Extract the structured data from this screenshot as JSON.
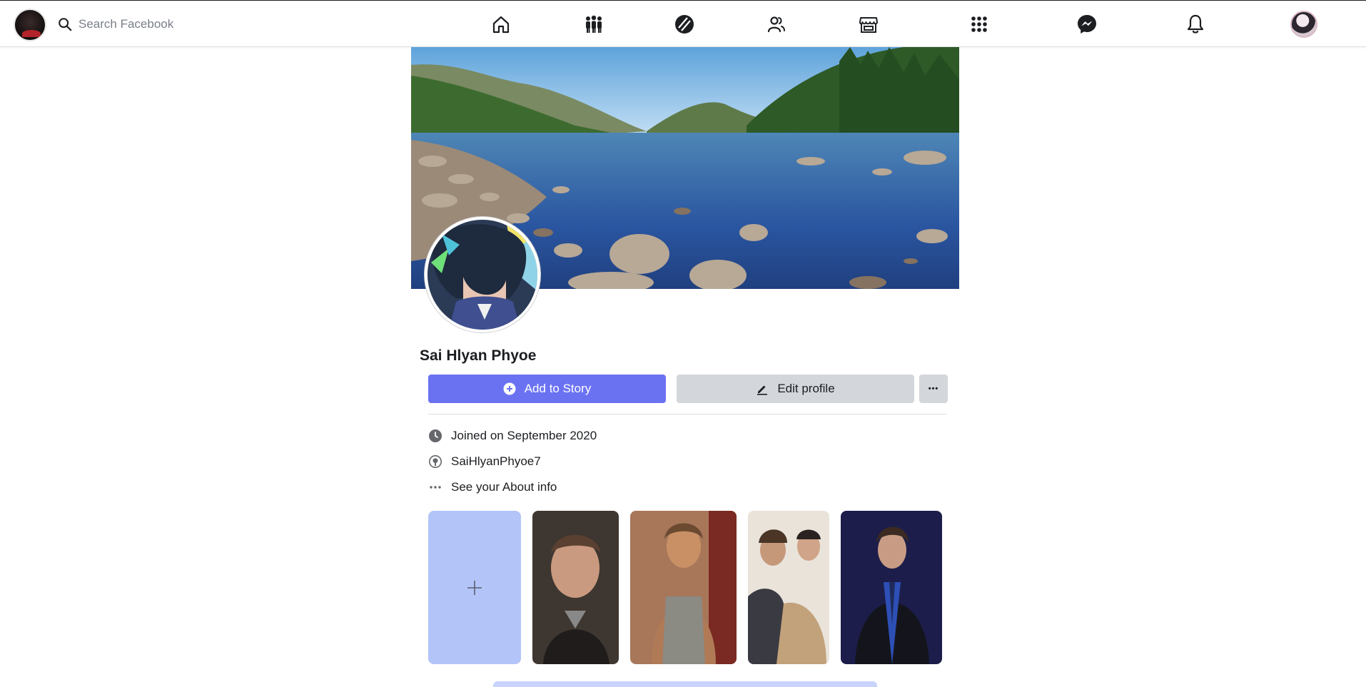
{
  "search": {
    "placeholder": "Search Facebook"
  },
  "nav": {
    "icons": [
      "home-icon",
      "groups-icon",
      "watch-icon",
      "friends-icon",
      "marketplace-icon",
      "menu-grid-icon",
      "messenger-icon",
      "notifications-icon"
    ]
  },
  "profile": {
    "name": "Sai Hlyan Phyoe",
    "add_story_label": "Add to Story",
    "edit_profile_label": "Edit profile",
    "more_label": "•••"
  },
  "intro": {
    "joined": "Joined on September 2020",
    "github": "SaiHlyanPhyoe7",
    "about": "See your About info"
  },
  "colors": {
    "accent": "#6b72f2",
    "secondary_button": "#d3d6db",
    "story_add": "#b3c4f8"
  }
}
